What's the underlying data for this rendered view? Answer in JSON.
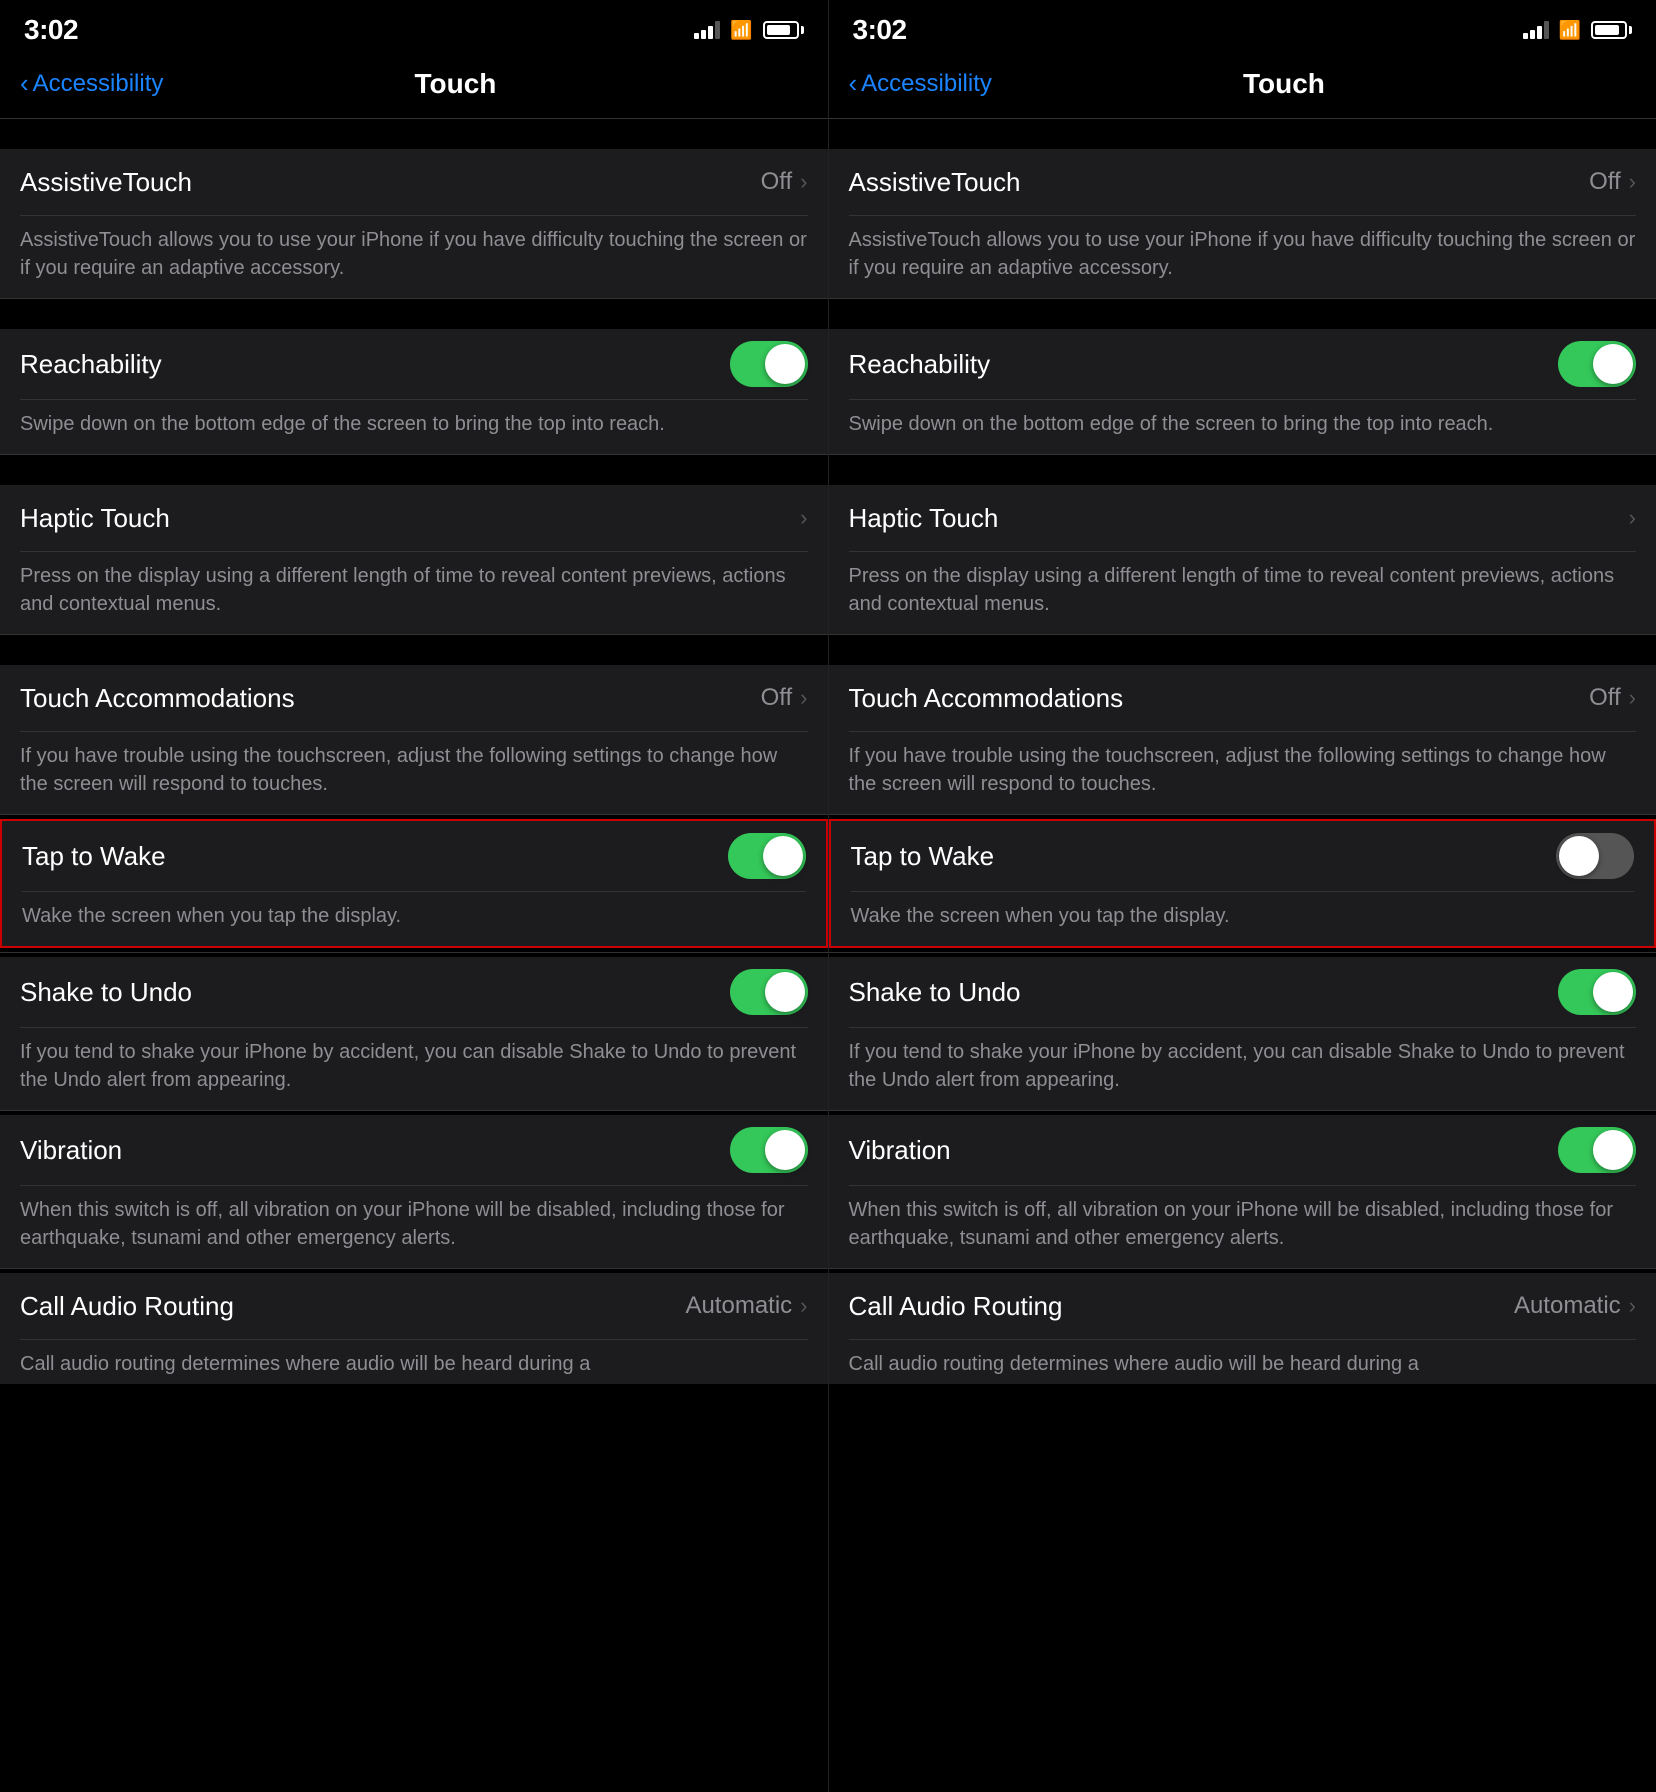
{
  "left_panel": {
    "status": {
      "time": "3:02"
    },
    "nav": {
      "back_label": "Accessibility",
      "title": "Touch"
    },
    "settings": [
      {
        "id": "assistive-touch",
        "label": "AssistiveTouch",
        "value": "Off",
        "has_chevron": true,
        "has_toggle": false,
        "toggle_on": false,
        "description": "AssistiveTouch allows you to use your iPhone if you have difficulty touching the screen or if you require an adaptive accessory."
      },
      {
        "id": "reachability",
        "label": "Reachability",
        "value": "",
        "has_chevron": false,
        "has_toggle": true,
        "toggle_on": true,
        "description": "Swipe down on the bottom edge of the screen to bring the top into reach."
      },
      {
        "id": "haptic-touch",
        "label": "Haptic Touch",
        "value": "",
        "has_chevron": true,
        "has_toggle": false,
        "toggle_on": false,
        "description": "Press on the display using a different length of time to reveal content previews, actions and contextual menus."
      },
      {
        "id": "touch-accommodations",
        "label": "Touch Accommodations",
        "value": "Off",
        "has_chevron": true,
        "has_toggle": false,
        "toggle_on": false,
        "description": "If you have trouble using the touchscreen, adjust the following settings to change how the screen will respond to touches."
      },
      {
        "id": "tap-to-wake",
        "label": "Tap to Wake",
        "value": "",
        "has_chevron": false,
        "has_toggle": true,
        "toggle_on": true,
        "description": "Wake the screen when you tap the display.",
        "highlighted": true
      },
      {
        "id": "shake-to-undo",
        "label": "Shake to Undo",
        "value": "",
        "has_chevron": false,
        "has_toggle": true,
        "toggle_on": true,
        "description": "If you tend to shake your iPhone by accident, you can disable Shake to Undo to prevent the Undo alert from appearing."
      },
      {
        "id": "vibration",
        "label": "Vibration",
        "value": "",
        "has_chevron": false,
        "has_toggle": true,
        "toggle_on": true,
        "description": "When this switch is off, all vibration on your iPhone will be disabled, including those for earthquake, tsunami and other emergency alerts."
      },
      {
        "id": "call-audio-routing",
        "label": "Call Audio Routing",
        "value": "Automatic",
        "has_chevron": true,
        "has_toggle": false,
        "toggle_on": false,
        "description": "Call audio routing determines where audio will be heard during a"
      }
    ]
  },
  "right_panel": {
    "status": {
      "time": "3:02"
    },
    "nav": {
      "back_label": "Accessibility",
      "title": "Touch"
    },
    "settings": [
      {
        "id": "assistive-touch",
        "label": "AssistiveTouch",
        "value": "Off",
        "has_chevron": true,
        "has_toggle": false,
        "toggle_on": false,
        "description": "AssistiveTouch allows you to use your iPhone if you have difficulty touching the screen or if you require an adaptive accessory."
      },
      {
        "id": "reachability",
        "label": "Reachability",
        "value": "",
        "has_chevron": false,
        "has_toggle": true,
        "toggle_on": true,
        "description": "Swipe down on the bottom edge of the screen to bring the top into reach."
      },
      {
        "id": "haptic-touch",
        "label": "Haptic Touch",
        "value": "",
        "has_chevron": true,
        "has_toggle": false,
        "toggle_on": false,
        "description": "Press on the display using a different length of time to reveal content previews, actions and contextual menus."
      },
      {
        "id": "touch-accommodations",
        "label": "Touch Accommodations",
        "value": "Off",
        "has_chevron": true,
        "has_toggle": false,
        "toggle_on": false,
        "description": "If you have trouble using the touchscreen, adjust the following settings to change how the screen will respond to touches."
      },
      {
        "id": "tap-to-wake",
        "label": "Tap to Wake",
        "value": "",
        "has_chevron": false,
        "has_toggle": true,
        "toggle_on": false,
        "description": "Wake the screen when you tap the display.",
        "highlighted": true
      },
      {
        "id": "shake-to-undo",
        "label": "Shake to Undo",
        "value": "",
        "has_chevron": false,
        "has_toggle": true,
        "toggle_on": true,
        "description": "If you tend to shake your iPhone by accident, you can disable Shake to Undo to prevent the Undo alert from appearing."
      },
      {
        "id": "vibration",
        "label": "Vibration",
        "value": "",
        "has_chevron": false,
        "has_toggle": true,
        "toggle_on": true,
        "description": "When this switch is off, all vibration on your iPhone will be disabled, including those for earthquake, tsunami and other emergency alerts."
      },
      {
        "id": "call-audio-routing",
        "label": "Call Audio Routing",
        "value": "Automatic",
        "has_chevron": true,
        "has_toggle": false,
        "toggle_on": false,
        "description": "Call audio routing determines where audio will be heard during a"
      }
    ]
  }
}
